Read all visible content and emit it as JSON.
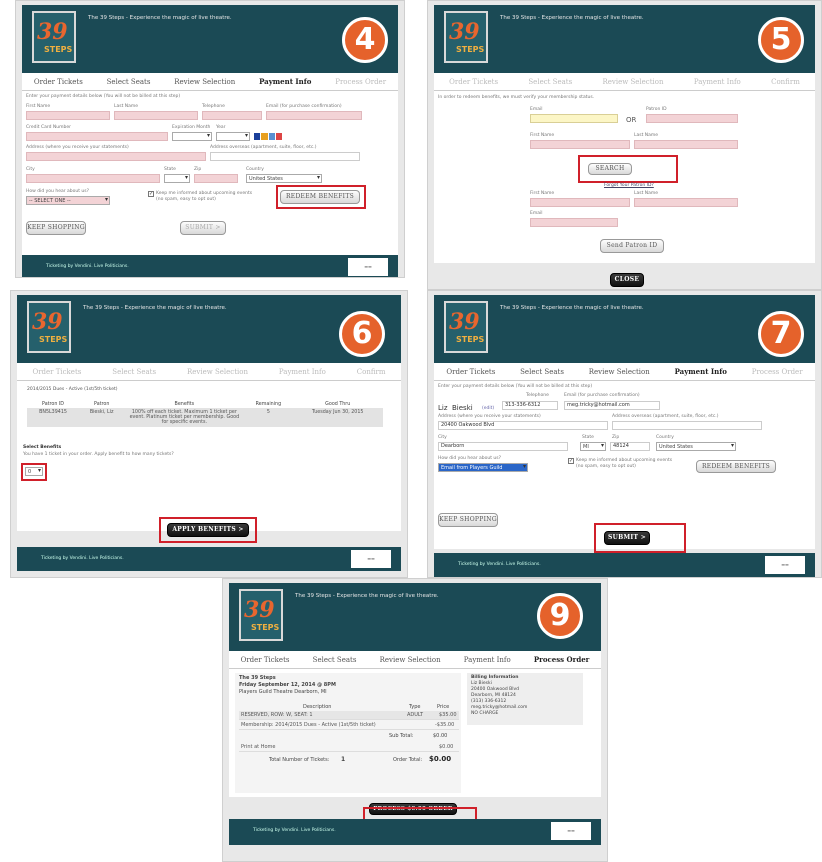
{
  "header": {
    "tagline": "The 39 Steps - Experience the magic of live theatre.",
    "logo_num": "39",
    "logo_text": "STEPS"
  },
  "footer": {
    "text": "Ticketing by Vendini. Live Politicians."
  },
  "steps": {
    "s4": "4",
    "s5": "5",
    "s6": "6",
    "s7": "7",
    "s9": "9"
  },
  "tabs": {
    "order": "Order Tickets",
    "seats": "Select Seats",
    "review": "Review Selection",
    "payment": "Payment Info",
    "process": "Process Order",
    "confirm": "Confirm"
  },
  "panel4": {
    "instr": "Enter your payment details below (You will not be billed at this step)",
    "first_name": "First Name",
    "last_name": "Last Name",
    "telephone": "Telephone",
    "email": "Email (for purchase confirmation)",
    "card": "Credit Card Number",
    "exp_month": "Expiration Month",
    "year": "Year",
    "address": "Address (where you receive your statements)",
    "address2": "Address overseas (apartment, suite, floor, etc.)",
    "city": "City",
    "state": "State",
    "zip": "Zip",
    "country": "Country",
    "country_val": "United States",
    "hear": "How did you hear about us?",
    "hear_val": "-- SELECT ONE --",
    "keep": "Keep me informed about upcoming events (no spam, easy to opt out)",
    "redeem": "REDEEM BENEFITS",
    "keep_shopping": "KEEP SHOPPING",
    "submit": "SUBMIT >"
  },
  "panel5": {
    "instr": "In order to redeem benefits, we must verify your membership status.",
    "email": "Email",
    "or": "OR",
    "patron_id": "Patron ID",
    "first_name": "First Name",
    "last_name": "Last Name",
    "search": "SEARCH",
    "forgot": "Forgot Your Patron ID?",
    "email2": "Email",
    "send": "Send Patron ID",
    "close": "CLOSE"
  },
  "panel6": {
    "section": "2014/2015 Dues - Active (1st/5th ticket)",
    "cols": [
      "Patron ID",
      "Patron",
      "Benefits",
      "Remaining",
      "Good Thru"
    ],
    "row": [
      "BN5L39415",
      "Bieski, Liz",
      "100% off each ticket. Maximum 1 ticket per event. Platinum ticket per membership. Good for specific events.",
      "5",
      "Tuesday Jun 30, 2015"
    ],
    "select_title": "Select Benefits",
    "select_text": "You have 1 ticket in your order. Apply benefit to how many tickets?",
    "select_val": "0",
    "apply": "APPLY BENEFITS >"
  },
  "panel7": {
    "instr": "Enter your payment details below (You will not be billed at this step)",
    "name1": "Liz",
    "name2": "Bieski",
    "edit": "(edit)",
    "telephone": "Telephone",
    "tel_val": "313-336-6312",
    "email": "Email (for purchase confirmation)",
    "email_val": "meg.tricky@hotmail.com",
    "address": "Address (where you receive your statements)",
    "address_val": "20400 Oakwood Blvd",
    "address2": "Address overseas (apartment, suite, floor, etc.)",
    "city": "City",
    "city_val": "Dearborn",
    "state": "State",
    "state_val": "MI",
    "zip": "Zip",
    "zip_val": "48124",
    "country": "Country",
    "country_val": "United States",
    "hear": "How did you hear about us?",
    "hear_val": "Email from Players Guild",
    "keep": "Keep me informed about upcoming events (no spam, easy to opt out)",
    "redeem": "REDEEM BENEFITS",
    "keep_shopping": "KEEP SHOPPING",
    "submit": "SUBMIT >"
  },
  "panel9": {
    "show": "The 39 Steps",
    "date": "Friday September 12, 2014 @ 8PM",
    "venue": "Players Guild Theatre Dearborn, MI",
    "billing": [
      "Billing Information",
      "Liz Bieski",
      "20400 Oakwood Blvd",
      "Dearborn, MI 48124",
      "(313) 336-6312",
      "meg.tricky@hotmail.com",
      "NO CHARGE"
    ],
    "col_desc": "Description",
    "col_type": "Type",
    "col_price": "Price",
    "line1": "RESERVED, ROW: W, SEAT: 1",
    "line1_type": "ADULT",
    "line1_price": "$35.00",
    "line2": "Membership: 2014/2015 Dues - Active (1st/5th ticket)",
    "line2_price": "-$35.00",
    "subtotal_lbl": "Sub Total:",
    "subtotal": "$0.00",
    "print": "Print at Home",
    "print_price": "$0.00",
    "total_tix_lbl": "Total Number of Tickets:",
    "total_tix": "1",
    "order_total_lbl": "Order Total:",
    "order_total": "$0.00",
    "process": "PROCESS $0.00 ORDER"
  },
  "colors": {
    "header": "#1b4a55",
    "step": "#e5622b",
    "highlight": "#d0202a",
    "required": "#f3d3d6"
  }
}
